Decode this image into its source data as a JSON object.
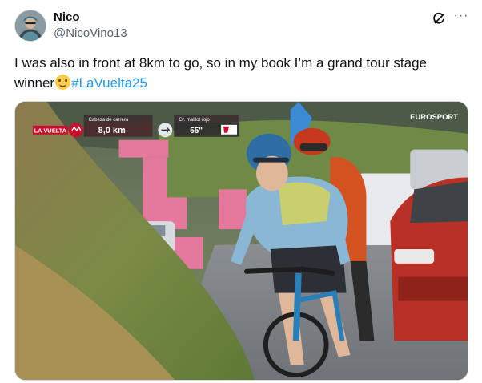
{
  "author": {
    "name": "Nico",
    "handle": "@NicoVino13"
  },
  "tweet": {
    "text_before": "I was also in front at 8km to go, so in my book I’m a grand tour stage winner",
    "emoji": "face-savoring-food-emoji",
    "hashtag": "#LaVuelta25"
  },
  "header_icons": {
    "grok": "grok-icon",
    "more": "more-icon",
    "more_glyph": "···"
  },
  "media": {
    "race_logo": "LA VUELTA",
    "broadcaster": "EUROSPORT",
    "leader_label": "Cabeza de carrera",
    "leader_distance": "8,0 km",
    "gc_label": "Gr. maillot rojo",
    "gc_gap": "55\""
  },
  "colors": {
    "accent": "#1d9bf0",
    "text": "#0f1419",
    "muted": "#536471",
    "vuelta_red": "#c8102e"
  }
}
